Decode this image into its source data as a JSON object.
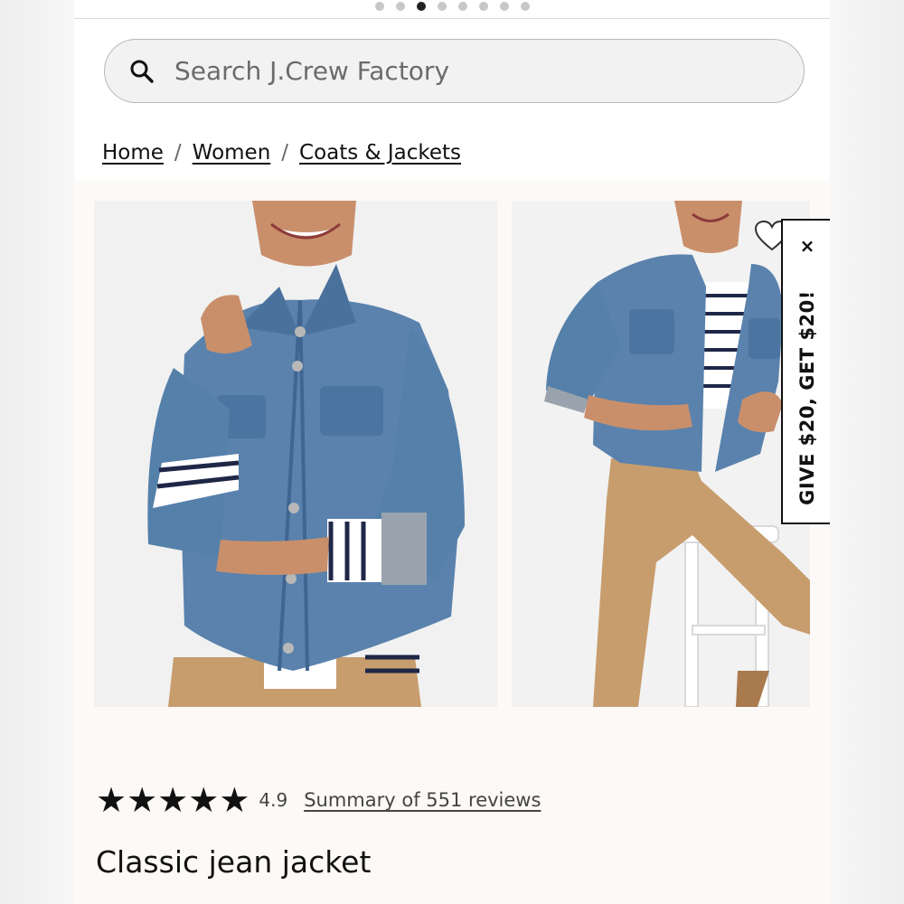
{
  "carousel": {
    "dot_count": 8,
    "active_index": 2
  },
  "search": {
    "placeholder": "Search J.Crew Factory",
    "value": ""
  },
  "breadcrumb": {
    "items": [
      {
        "label": "Home"
      },
      {
        "label": "Women"
      },
      {
        "label": "Coats & Jackets"
      }
    ],
    "separator": "/"
  },
  "product": {
    "images": [
      {
        "alt": "Model wearing classic jean jacket, front view"
      },
      {
        "alt": "Model wearing classic jean jacket seated on white stool"
      }
    ],
    "rating": {
      "value": "4.9",
      "stars": 5,
      "reviews_label": "Summary of 551 reviews"
    },
    "title": "Classic jean jacket"
  },
  "promo": {
    "text": "GIVE $20, GET $20!",
    "close_label": "×"
  },
  "colors": {
    "denim": "#4f79a6",
    "khaki": "#c79d6e",
    "accent": "#111111",
    "background": "#fcf9f6"
  },
  "icons": {
    "search": "search-icon",
    "favorite": "heart-icon",
    "close": "close-icon",
    "star": "star-icon"
  }
}
